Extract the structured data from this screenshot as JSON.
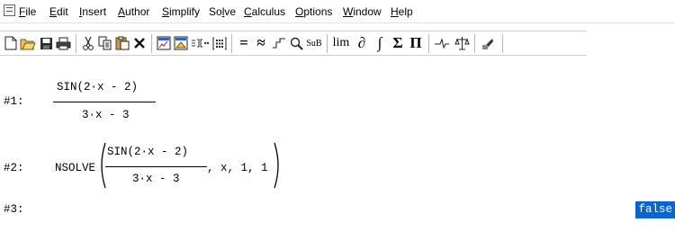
{
  "menu": {
    "items": [
      {
        "label": "File",
        "mnemonic": "F",
        "rest": "ile"
      },
      {
        "label": "Edit",
        "mnemonic": "E",
        "rest": "dit"
      },
      {
        "label": "Insert",
        "mnemonic": "I",
        "rest": "nsert"
      },
      {
        "label": "Author",
        "mnemonic": "A",
        "rest": "uthor"
      },
      {
        "label": "Simplify",
        "mnemonic": "S",
        "rest": "implify"
      },
      {
        "label": "Solve",
        "pre": "So",
        "mnemonic": "l",
        "rest": "ve"
      },
      {
        "label": "Calculus",
        "mnemonic": "C",
        "rest": "alculus"
      },
      {
        "label": "Options",
        "mnemonic": "O",
        "rest": "ptions"
      },
      {
        "label": "Window",
        "mnemonic": "W",
        "rest": "indow"
      },
      {
        "label": "Help",
        "mnemonic": "H",
        "rest": "elp"
      }
    ]
  },
  "toolbar": {
    "approx_symbol": "≈",
    "equals_symbol": "=",
    "sub_label": "SuB",
    "lim_label": "lim",
    "partial_symbol": "∂",
    "integral_symbol": "∫",
    "sum_symbol": "Σ",
    "product_symbol": "Π",
    "icons": [
      "new-file-icon",
      "open-folder-icon",
      "save-icon",
      "print-icon",
      "cut-icon",
      "copy-icon",
      "paste-icon",
      "delete-icon",
      "insert-plot-2d-icon",
      "insert-plot-3d-icon",
      "author-expression-icon",
      "author-matrix-icon",
      "equals-icon",
      "approximate-icon",
      "solve-icon",
      "find-icon",
      "substitute-icon",
      "limit-icon",
      "derivative-icon",
      "integral-icon",
      "sum-icon",
      "product-icon",
      "vector-icon",
      "scale-icon",
      "ti-icon"
    ]
  },
  "worksheet": {
    "expr1": {
      "label": "#1:",
      "numerator": "SIN(2·x - 2)",
      "denominator": "3·x - 3"
    },
    "expr2": {
      "label": "#2:",
      "func": "NSOLVE",
      "numerator": "SIN(2·x - 2)",
      "denominator": "3·x - 3",
      "args": ", x, 1, 1"
    },
    "expr3": {
      "label": "#3:",
      "result": "false"
    },
    "highlight_color": "#0a66cc"
  }
}
